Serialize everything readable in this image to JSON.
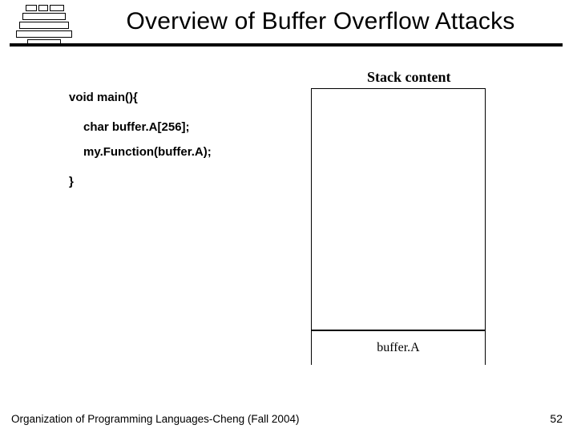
{
  "title": "Overview of Buffer Overflow Attacks",
  "stack_label": "Stack content",
  "code": {
    "line1": "void main(){",
    "line2": "char buffer.A[256];",
    "line3": "my.Function(buffer.A);",
    "line4": "}"
  },
  "buffer_label": "buffer.A",
  "footer": "Organization of Programming Languages-Cheng (Fall 2004)",
  "page_number": "52"
}
